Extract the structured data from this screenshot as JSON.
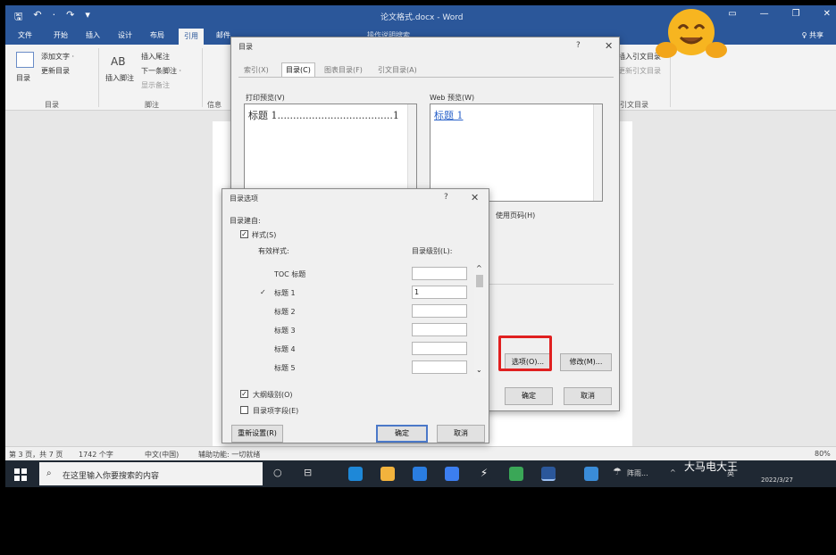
{
  "titlebar": {
    "doc_title": "论文格式.docx - Word",
    "qat": [
      "🖫",
      "↶",
      "·",
      "↷",
      "▾"
    ],
    "win": [
      "▭",
      "—",
      "❐",
      "✕"
    ]
  },
  "ribbon_tabs": {
    "items": [
      "文件",
      "开始",
      "插入",
      "设计",
      "布局",
      "引用",
      "邮件"
    ],
    "active": "引用",
    "search": "操作说明搜索",
    "share": "♀ 共享"
  },
  "ribbon": {
    "toc_group": {
      "button": "目录",
      "add_text": "添加文字 ·",
      "update": "更新目录",
      "group_label": "目录"
    },
    "footnote_group": {
      "insert_footnote": "插入脚注",
      "insert_endnote": "插入尾注",
      "next_footnote": "下一条脚注 ·",
      "show_notes": "显示备注",
      "group_label": "脚注",
      "ab": "AB"
    },
    "info_label": "信息",
    "toa_group": {
      "insert": "插入引文目录",
      "update": "更新引文目录",
      "group_label": "引文目录"
    }
  },
  "toc_dialog": {
    "title": "目录",
    "help": "?",
    "close": "✕",
    "tabs": [
      "索引(X)",
      "目录(C)",
      "图表目录(F)",
      "引文目录(A)"
    ],
    "active_tab": "目录(C)",
    "print_preview_label": "打印预览(V)",
    "print_preview_entry": "标题 1.....................................1",
    "web_preview_label": "Web 预览(W)",
    "web_preview_entry": "标题 1",
    "hyperlink_label": "使用超链接而不使用页码(H)",
    "hyperlink_visible": "使用页码(H)",
    "options_button": "选项(O)...",
    "modify_button": "修改(M)...",
    "ok_button": "确定",
    "cancel_button": "取消"
  },
  "options_dialog": {
    "title": "目录选项",
    "help": "?",
    "close": "✕",
    "build_from_label": "目录建自:",
    "styles_label": "样式(S)",
    "available_styles_label": "有效样式:",
    "toc_level_label": "目录级别(L):",
    "rows": [
      {
        "style": "TOC 标题",
        "level": "",
        "checked": false
      },
      {
        "style": "标题 1",
        "level": "1",
        "checked": true
      },
      {
        "style": "标题 2",
        "level": "",
        "checked": false
      },
      {
        "style": "标题 3",
        "level": "",
        "checked": false
      },
      {
        "style": "标题 4",
        "level": "",
        "checked": false
      },
      {
        "style": "标题 5",
        "level": "",
        "checked": false
      }
    ],
    "outline_label": "大纲级别(O)",
    "entry_fields_label": "目录项字段(E)",
    "reset_button": "重新设置(R)",
    "ok_button": "确定",
    "cancel_button": "取消"
  },
  "statusbar": {
    "page": "第 3 页，共 7 页",
    "words": "1742 个字",
    "lang": "中文(中国)",
    "accessibility": "辅助功能: 一切就绪",
    "zoom": "80%"
  },
  "taskbar": {
    "search_placeholder": "在这里输入你要搜索的内容",
    "weather": "阵雨...",
    "ime": "英",
    "date": "2022/3/27",
    "watermark": "大马电大王"
  }
}
